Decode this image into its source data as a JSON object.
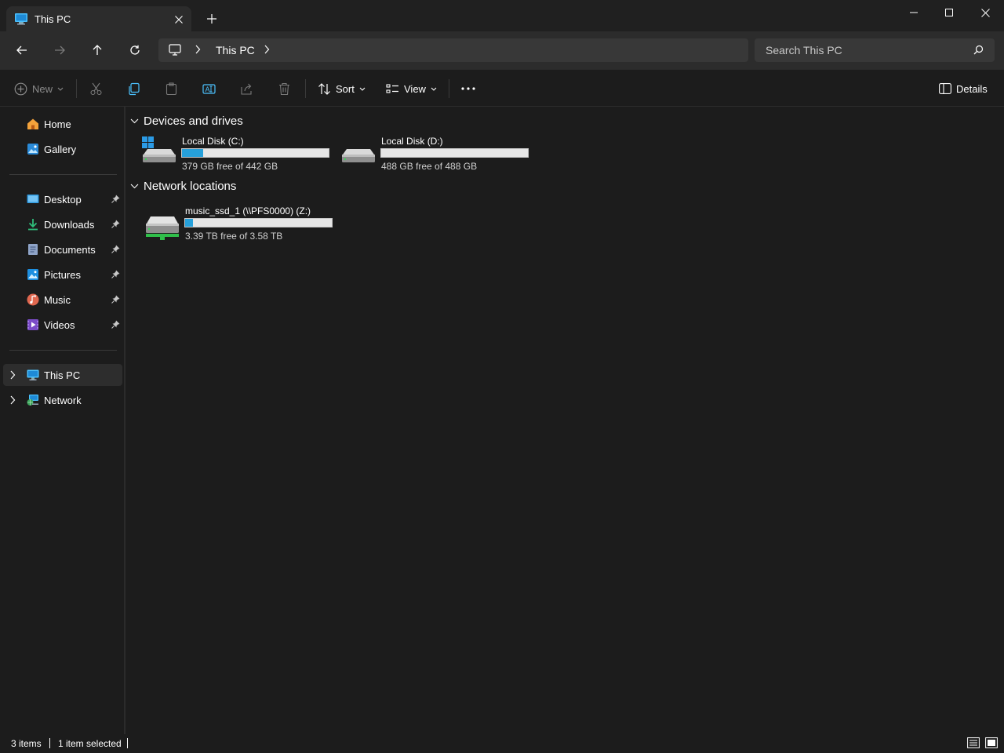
{
  "window": {
    "tab_title": "This PC",
    "tab_icon": "monitor-icon",
    "controls": [
      "minimize-icon",
      "maximize-icon",
      "close-icon"
    ]
  },
  "address": {
    "breadcrumb": [
      "This PC"
    ],
    "search_placeholder": "Search This PC"
  },
  "commands": {
    "new_label": "New",
    "sort_label": "Sort",
    "view_label": "View",
    "details_label": "Details",
    "icons": [
      "cut-icon",
      "copy-icon",
      "paste-icon",
      "rename-icon",
      "share-icon",
      "delete-icon",
      "more-icon"
    ]
  },
  "nav": {
    "top": [
      {
        "label": "Home",
        "icon": "home-icon"
      },
      {
        "label": "Gallery",
        "icon": "gallery-icon"
      }
    ],
    "quick_access": [
      {
        "label": "Desktop",
        "icon": "desktop-icon"
      },
      {
        "label": "Downloads",
        "icon": "downloads-icon"
      },
      {
        "label": "Documents",
        "icon": "documents-icon"
      },
      {
        "label": "Pictures",
        "icon": "pictures-icon"
      },
      {
        "label": "Music",
        "icon": "music-icon"
      },
      {
        "label": "Videos",
        "icon": "videos-icon"
      }
    ],
    "tree": [
      {
        "label": "This PC",
        "icon": "this-pc-icon",
        "selected": true
      },
      {
        "label": "Network",
        "icon": "network-icon",
        "selected": false
      }
    ]
  },
  "content": {
    "groups": [
      {
        "title": "Devices and drives",
        "drives": [
          {
            "name": "Local Disk (C:)",
            "free": "379 GB free of 442 GB",
            "used_fraction": 0.142,
            "icon": "system-drive-icon"
          },
          {
            "name": "Local Disk (D:)",
            "free": "488 GB free of 488 GB",
            "used_fraction": 0.0,
            "icon": "drive-icon"
          }
        ]
      },
      {
        "title": "Network locations",
        "drives": [
          {
            "name": "music_ssd_1 (\\\\PFS0000) (Z:)",
            "free": "3.39 TB free of 3.58 TB",
            "used_fraction": 0.053,
            "icon": "network-drive-icon"
          }
        ]
      }
    ]
  },
  "status": {
    "items": "3 items",
    "selected": "1 item selected"
  },
  "colors": {
    "accent": "#26a0da",
    "background": "#1c1c1c",
    "toolbar": "#2c2c2c"
  }
}
